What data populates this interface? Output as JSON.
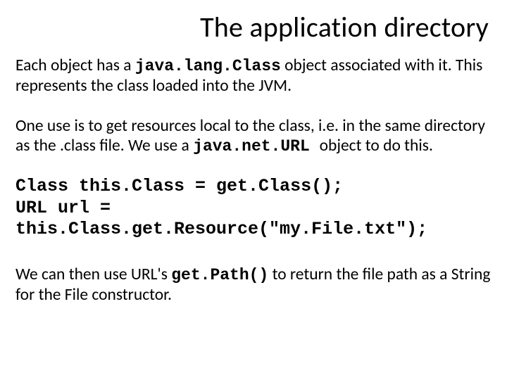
{
  "title": "The application directory",
  "p1": {
    "a": "Each object has a ",
    "code": "java.lang.Class",
    "b": " object associated with it. This represents the class loaded into the JVM."
  },
  "p2": {
    "a": "One use is to get resources local to the class, i.e. in the same directory as the .class file. We use a ",
    "code": " java.net.URL ",
    "b": " object to do this."
  },
  "code": {
    "l1": "Class this.Class = get.Class();",
    "l2": "URL url =",
    "l3": "this.Class.get.Resource(\"my.File.txt\");"
  },
  "p3": {
    "a": "We can then use URL's ",
    "code": "get.Path()",
    "b": " to return the file path as a String for the File constructor."
  }
}
